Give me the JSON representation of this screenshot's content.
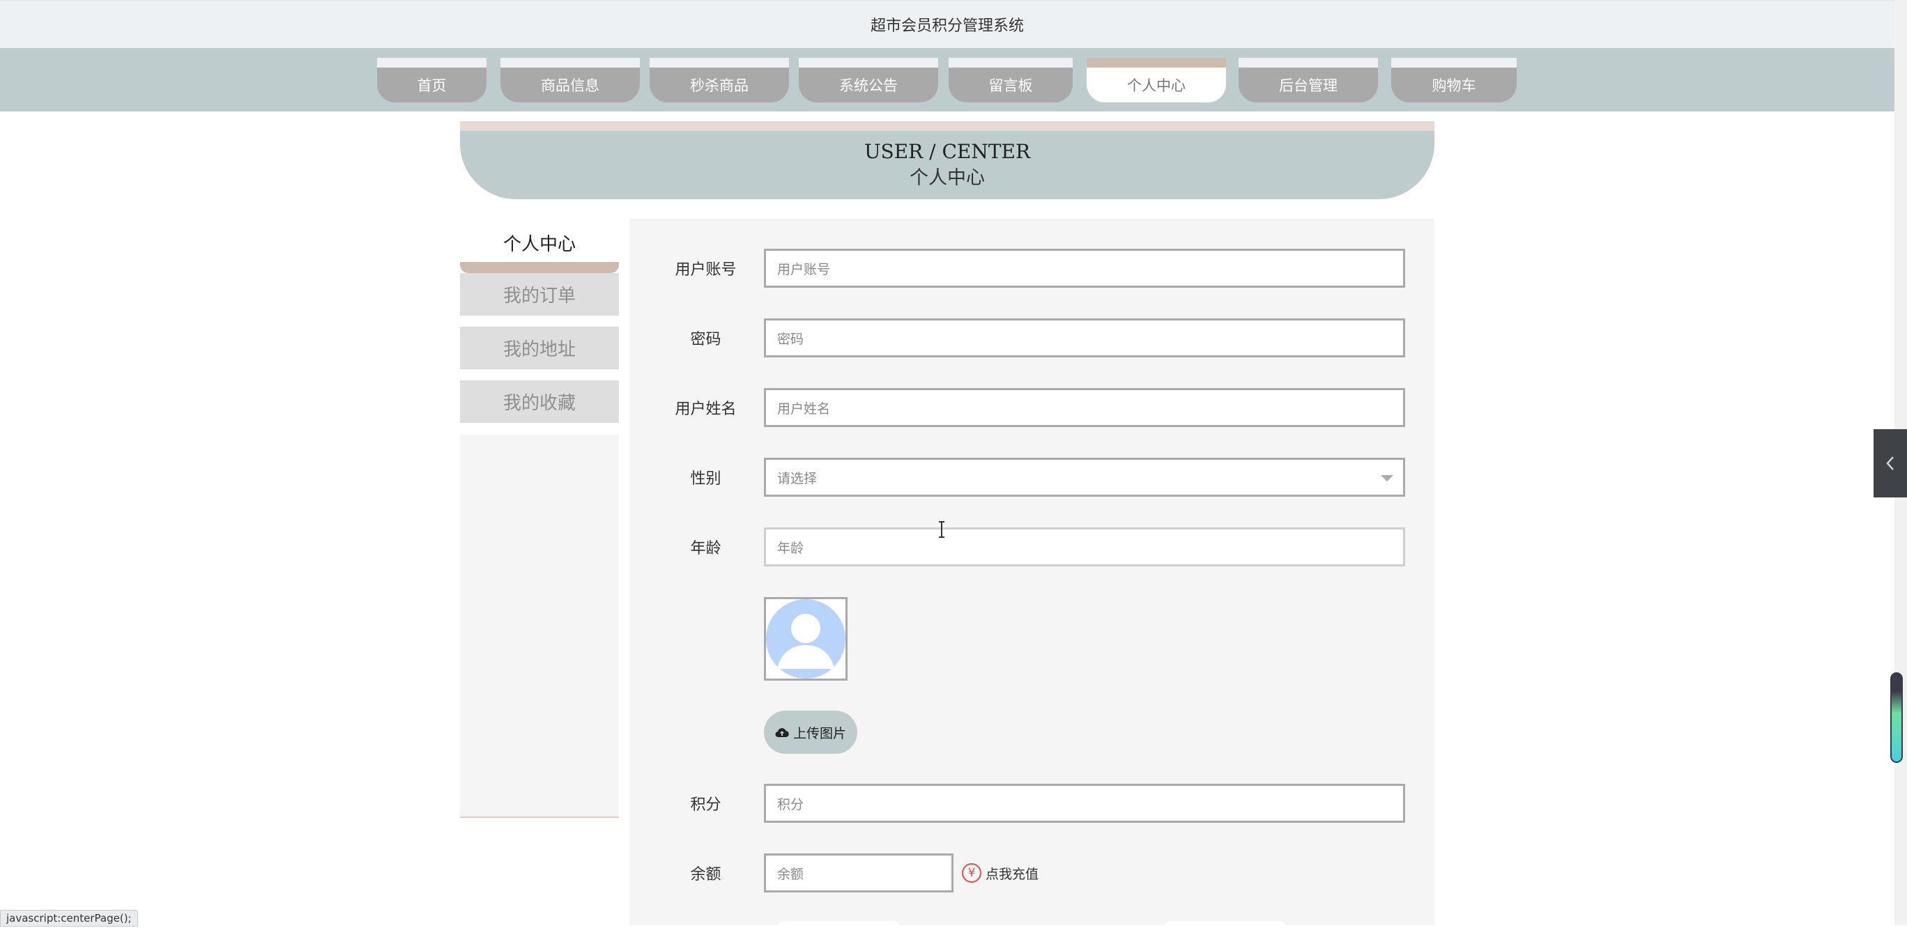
{
  "window": {
    "title": "超市会员积分管理系统"
  },
  "nav": {
    "items": [
      {
        "label": "首页"
      },
      {
        "label": "商品信息"
      },
      {
        "label": "秒杀商品"
      },
      {
        "label": "系统公告"
      },
      {
        "label": "留言板"
      },
      {
        "label": "个人中心",
        "active": true
      },
      {
        "label": "后台管理"
      },
      {
        "label": "购物车"
      }
    ]
  },
  "banner": {
    "en": "USER / CENTER",
    "cn": "个人中心"
  },
  "sidebar": {
    "title": "个人中心",
    "items": [
      {
        "label": "我的订单"
      },
      {
        "label": "我的地址"
      },
      {
        "label": "我的收藏"
      }
    ]
  },
  "form": {
    "account": {
      "label": "用户账号",
      "placeholder": "用户账号"
    },
    "password": {
      "label": "密码",
      "placeholder": "密码"
    },
    "name": {
      "label": "用户姓名",
      "placeholder": "用户姓名"
    },
    "gender": {
      "label": "性别",
      "selected": "请选择"
    },
    "age": {
      "label": "年龄",
      "placeholder": "年龄"
    },
    "upload_label": "上传图片",
    "points": {
      "label": "积分",
      "placeholder": "积分"
    },
    "balance": {
      "label": "余额",
      "placeholder": "余额"
    },
    "recharge_label": "点我充值"
  },
  "status_bar": {
    "text": "javascript:centerPage();"
  },
  "colors": {
    "nav_bg": "#bfcccd",
    "nav_item": "#a9a9a9",
    "accent": "#cfbbad",
    "panel": "#f5f5f5",
    "recharge_red": "#e05050"
  },
  "icons": {
    "upload": "cloud-upload-icon",
    "recharge": "yen-icon",
    "toggle": "chevron-left-icon",
    "avatar": "default-avatar-icon"
  }
}
